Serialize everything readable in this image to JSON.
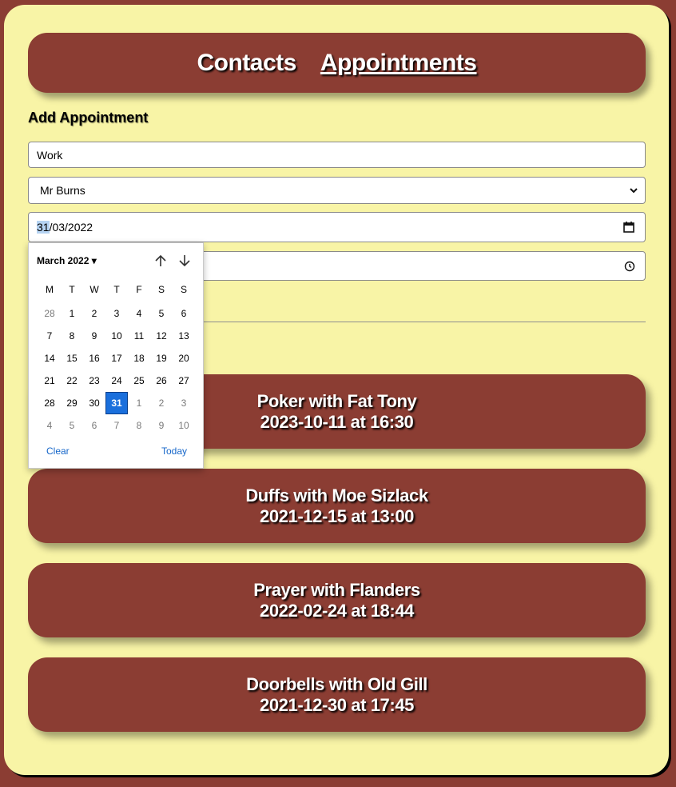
{
  "nav": {
    "contacts_label": "Contacts",
    "appointments_label": "Appointments"
  },
  "form": {
    "title": "Add Appointment",
    "title_value": "Work",
    "contact_value": "Mr Burns",
    "date_day": "31",
    "date_rest": "/03/2022"
  },
  "picker": {
    "month_label": "March 2022",
    "weekdays": [
      "M",
      "T",
      "W",
      "T",
      "F",
      "S",
      "S"
    ],
    "days": [
      [
        "28",
        "1",
        "2",
        "3",
        "4",
        "5",
        "6"
      ],
      [
        "7",
        "8",
        "9",
        "10",
        "11",
        "12",
        "13"
      ],
      [
        "14",
        "15",
        "16",
        "17",
        "18",
        "19",
        "20"
      ],
      [
        "21",
        "22",
        "23",
        "24",
        "25",
        "26",
        "27"
      ],
      [
        "28",
        "29",
        "30",
        "31",
        "1",
        "2",
        "3"
      ],
      [
        "4",
        "5",
        "6",
        "7",
        "8",
        "9",
        "10"
      ]
    ],
    "selected_day": "31",
    "clear_label": "Clear",
    "today_label": "Today"
  },
  "appointments": [
    {
      "line1": "Poker with Fat Tony",
      "line2": "2023-10-11 at 16:30"
    },
    {
      "line1": "Duffs with Moe Sizlack",
      "line2": "2021-12-15 at 13:00"
    },
    {
      "line1": "Prayer with Flanders",
      "line2": "2022-02-24 at 18:44"
    },
    {
      "line1": "Doorbells with Old Gill",
      "line2": "2021-12-30 at 17:45"
    }
  ],
  "colors": {
    "panel": "#f8f4a6",
    "brand": "#8b3d33",
    "accent": "#1a6fdc"
  }
}
